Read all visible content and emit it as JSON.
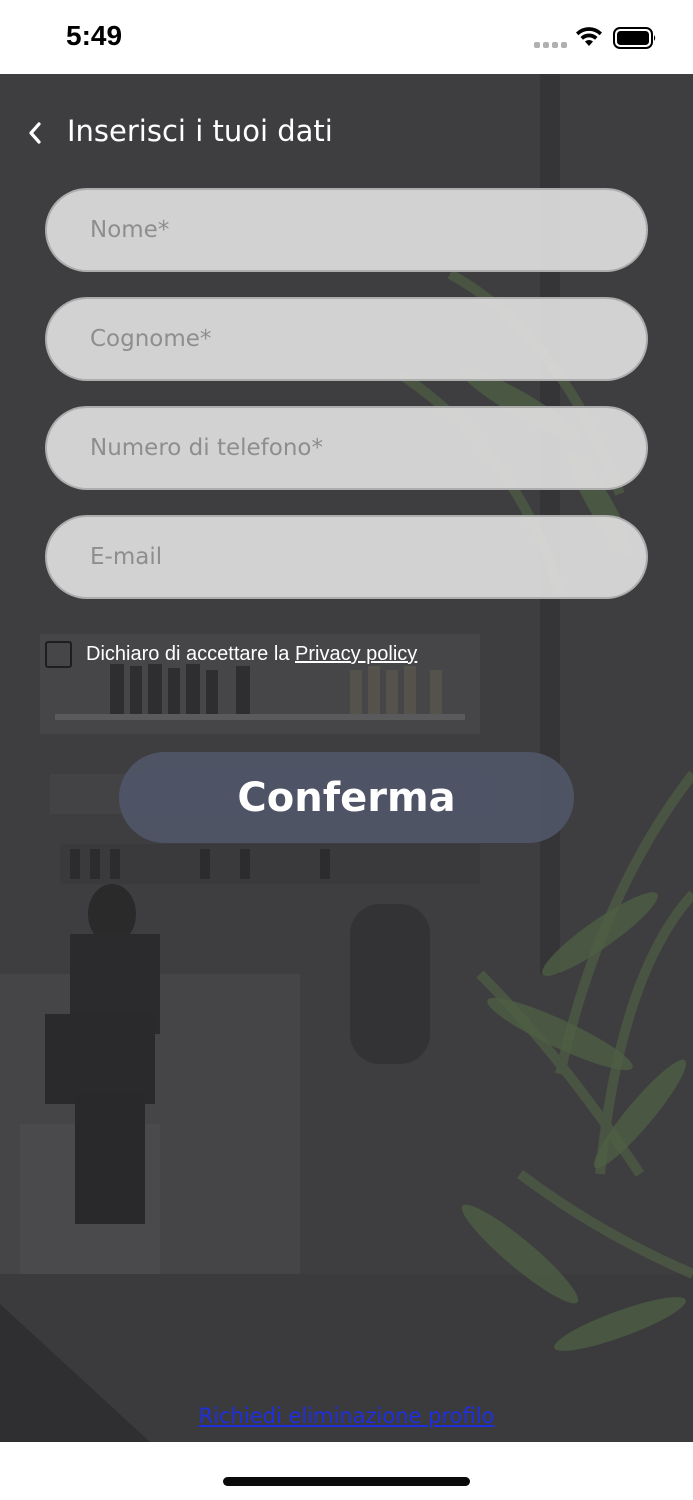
{
  "status_bar": {
    "time": "5:49"
  },
  "header": {
    "back_icon": "chevron-left-icon",
    "title": "Inserisci i tuoi dati"
  },
  "form": {
    "nome_placeholder": "Nome*",
    "cognome_placeholder": "Cognome*",
    "telefono_placeholder": "Numero di telefono*",
    "email_placeholder": "E-mail",
    "privacy_text": "Dichiaro di accettare la",
    "privacy_link": "Privacy policy",
    "privacy_checked": false
  },
  "confirm_label": "Conferma",
  "delete_profile_link": "Richiedi eliminazione profilo",
  "colors": {
    "overlay": "#3f3f41",
    "button": "#505668",
    "link": "#1f2fe0"
  }
}
